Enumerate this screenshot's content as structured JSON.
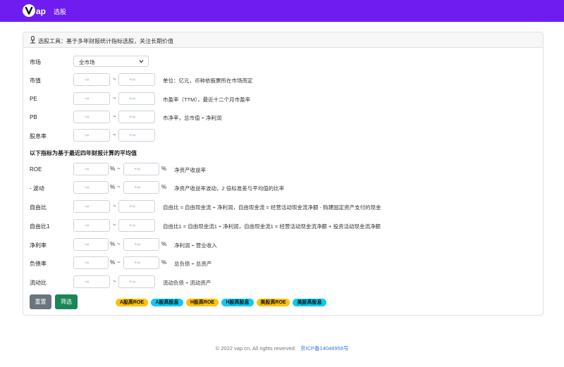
{
  "navbar": {
    "logo_text": "Vap",
    "title": "选股"
  },
  "card": {
    "header_text": "选股工具：基于多年财报统计指标选股，关注长期价值"
  },
  "market": {
    "label": "市场",
    "selected": "全市场"
  },
  "rows_top": [
    {
      "label": "市值",
      "min_placeholder": "-∞",
      "max_placeholder": "+∞",
      "sep": "~",
      "desc": "单位：亿元，币种依股票所在市场而定"
    },
    {
      "label": "PE",
      "min_placeholder": "-∞",
      "max_placeholder": "+∞",
      "sep": "~",
      "desc": "市盈率（TTM），最近十二个月市盈率"
    },
    {
      "label": "PB",
      "min_placeholder": "-∞",
      "max_placeholder": "+∞",
      "sep": "~",
      "desc": "市净率，总市值 ÷ 净利润"
    },
    {
      "label": "股息率",
      "min_placeholder": "-∞",
      "max_placeholder": "+∞",
      "sep": "~",
      "desc": ""
    }
  ],
  "section_title": "以下指标为基于最近四年财报计算的平均值",
  "rows_bottom": [
    {
      "label": "ROE",
      "min_placeholder": "-∞",
      "max_placeholder": "+∞",
      "sep": "~",
      "pct": "%",
      "desc": "净资产收益率"
    },
    {
      "label": "- 波动",
      "min_placeholder": "-∞",
      "max_placeholder": "+∞",
      "sep": "~",
      "pct": "%",
      "desc": "净资产收益率波动，2 倍标准差与平均值的比率"
    },
    {
      "label": "自由比",
      "min_placeholder": "-∞",
      "max_placeholder": "+∞",
      "sep": "~",
      "pct": "",
      "desc": "自由比 = 自由现金流 ÷ 净利润，自由现金流 = 经营活动现金流净额 - 购建固定资产支付的现金"
    },
    {
      "label": "自由比1",
      "min_placeholder": "-∞",
      "max_placeholder": "+∞",
      "sep": "~",
      "pct": "",
      "desc": "自由比1 = 自由现金流1 ÷ 净利润，自由现金流1 = 经营活动现金流净额 + 投资活动现金流净额"
    },
    {
      "label": "净利率",
      "min_placeholder": "-∞",
      "max_placeholder": "+∞",
      "sep": "~",
      "pct": "%",
      "desc": "净利润 ÷ 营业收入"
    },
    {
      "label": "负债率",
      "min_placeholder": "-∞",
      "max_placeholder": "+∞",
      "sep": "~",
      "pct": "%",
      "desc": "总负债 ÷ 总资产"
    },
    {
      "label": "流动比",
      "min_placeholder": "-∞",
      "max_placeholder": "+∞",
      "sep": "~",
      "pct": "",
      "desc": "流动负债 ÷ 流动资产"
    }
  ],
  "buttons": {
    "reset": "重置",
    "filter": "筛选"
  },
  "presets": [
    {
      "label": "A股高ROE",
      "color": "#ffc107"
    },
    {
      "label": "A股高股息",
      "color": "#0dcaf0"
    },
    {
      "label": "H股高ROE",
      "color": "#ffc107"
    },
    {
      "label": "H股高股息",
      "color": "#0dcaf0"
    },
    {
      "label": "美股高ROE",
      "color": "#ffc107"
    },
    {
      "label": "美股高股息",
      "color": "#0dcaf0"
    }
  ],
  "footer": {
    "copyright": "© 2022 vap.cn, All rights reserved.",
    "icp": "京ICP备14048959号"
  },
  "colors": {
    "navbar": "#6f1cf0",
    "reset": "#6c757d",
    "filter": "#198754"
  }
}
